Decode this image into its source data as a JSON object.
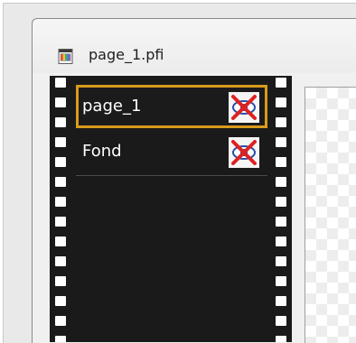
{
  "window": {
    "title": "page_1.pfi",
    "icon": "document-image-icon"
  },
  "pages": [
    {
      "label": "page_1",
      "selected": true,
      "visibility_icon": "eye-hidden-icon"
    },
    {
      "label": "Fond",
      "selected": false,
      "visibility_icon": "eye-hidden-icon"
    }
  ],
  "colors": {
    "selection_border": "#d99a1c",
    "filmstrip_bg": "#1a1a1a",
    "hidden_cross": "#e02020"
  }
}
